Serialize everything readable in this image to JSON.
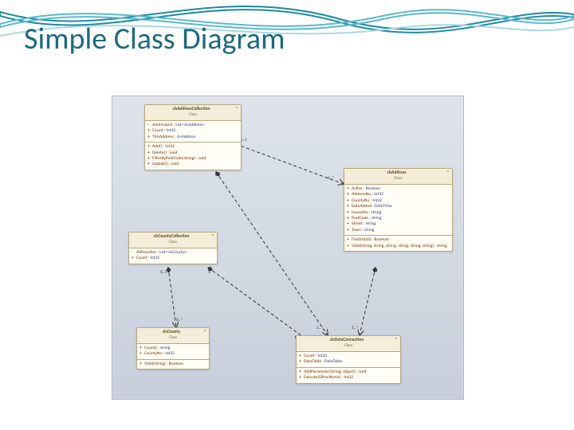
{
  "slide": {
    "title": "Simple Class Diagram"
  },
  "classes": {
    "addressCollection": {
      "name": "clsAddressCollection",
      "stereotype": "Class",
      "fields": [
        {
          "vis": "-",
          "name": "AddressList",
          "type": "List<clsAddress>"
        },
        {
          "vis": "+",
          "name": "Count",
          "type": "Int32"
        },
        {
          "vis": "+",
          "name": "ThisAddress",
          "type": "clsAddress"
        }
      ],
      "methods": [
        {
          "vis": "+",
          "sig": "Add() : Int32"
        },
        {
          "vis": "+",
          "sig": "Delete() : void"
        },
        {
          "vis": "+",
          "sig": "FilterByPostCode(string) : void"
        },
        {
          "vis": "+",
          "sig": "Update() : void"
        }
      ]
    },
    "address": {
      "name": "clsAddress",
      "stereotype": "Class",
      "fields": [
        {
          "vis": "+",
          "name": "Active",
          "type": "Boolean"
        },
        {
          "vis": "+",
          "name": "AddressNo",
          "type": "Int32"
        },
        {
          "vis": "+",
          "name": "CountyNo",
          "type": "Int32"
        },
        {
          "vis": "+",
          "name": "DateAdded",
          "type": "DateTime"
        },
        {
          "vis": "+",
          "name": "HouseNo",
          "type": "string"
        },
        {
          "vis": "+",
          "name": "PostCode",
          "type": "string"
        },
        {
          "vis": "+",
          "name": "Street",
          "type": "string"
        },
        {
          "vis": "+",
          "name": "Town",
          "type": "string"
        }
      ],
      "methods": [
        {
          "vis": "+",
          "sig": "Find(Int32) : Boolean"
        },
        {
          "vis": "+",
          "sig": "Valid(string, string, string, string, string, string) : string"
        }
      ]
    },
    "countyCollection": {
      "name": "clsCountyCollection",
      "stereotype": "Class",
      "fields": [
        {
          "vis": "-",
          "name": "AllCounties",
          "type": "List<clsCounty>"
        },
        {
          "vis": "+",
          "name": "Count",
          "type": "Int32"
        }
      ],
      "methods": []
    },
    "county": {
      "name": "clsCounty",
      "stereotype": "Class",
      "fields": [
        {
          "vis": "+",
          "name": "County",
          "type": "string"
        },
        {
          "vis": "+",
          "name": "CountyNo",
          "type": "Int32"
        }
      ],
      "methods": [
        {
          "vis": "+",
          "sig": "Valid(string) : Boolean"
        }
      ]
    },
    "dataConnection": {
      "name": "clsDataConnection",
      "stereotype": "Class",
      "fields": [
        {
          "vis": "+",
          "name": "Count",
          "type": "Int32"
        },
        {
          "vis": "+",
          "name": "DataTable",
          "type": "DataTable"
        }
      ],
      "methods": [
        {
          "vis": "+",
          "sig": "AddParameter(string, object) : void"
        },
        {
          "vis": "+",
          "sig": "Execute(SProcName) : Int32"
        }
      ]
    }
  },
  "mults": {
    "m1": "0..1",
    "m2": "0..*",
    "m3": "1",
    "m4": "1..*",
    "m5": "0..1",
    "m6": "0..*",
    "m7": "1",
    "m8": "1..*",
    "m9": "1",
    "m10": "1..*"
  }
}
